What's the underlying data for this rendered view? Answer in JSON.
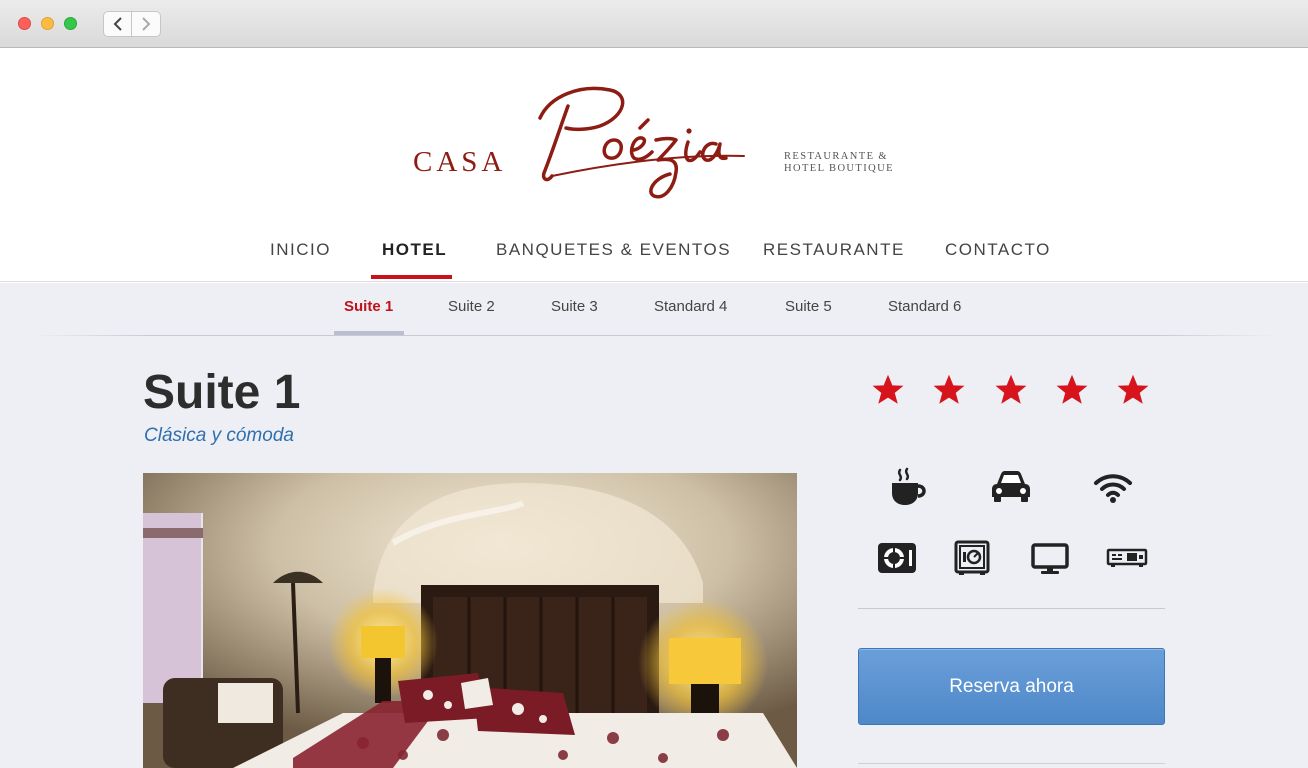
{
  "browser": {
    "back_icon": "chevron-left-icon",
    "forward_icon": "chevron-right-icon"
  },
  "brand": {
    "casa": "CASA",
    "script": "Poézia",
    "tagline_line1": "RESTAURANTE &",
    "tagline_line2": "HOTEL BOUTIQUE",
    "color": "#8d1c13"
  },
  "main_nav": {
    "items": [
      {
        "label": "INICIO"
      },
      {
        "label": "HOTEL"
      },
      {
        "label": "BANQUETES & EVENTOS"
      },
      {
        "label": "RESTAURANTE"
      },
      {
        "label": "CONTACTO"
      }
    ],
    "active": "HOTEL",
    "accent": "#c8111a"
  },
  "sub_nav": {
    "tabs": [
      {
        "label": "Suite 1"
      },
      {
        "label": "Suite 2"
      },
      {
        "label": "Suite 3"
      },
      {
        "label": "Standard 4"
      },
      {
        "label": "Suite 5"
      },
      {
        "label": "Standard 6"
      }
    ],
    "active": "Suite 1"
  },
  "room": {
    "title": "Suite 1",
    "subtitle": "Clásica y cómoda",
    "rating": 5,
    "rating_max": 5,
    "star_color": "#d7141c",
    "amenities": [
      "coffee-icon",
      "car-icon",
      "wifi-icon",
      "safe-dial-icon",
      "safe-box-icon",
      "tv-icon",
      "dvd-player-icon"
    ],
    "reserve_label": "Reserva ahora",
    "reserve_color": "#5a93d0"
  }
}
